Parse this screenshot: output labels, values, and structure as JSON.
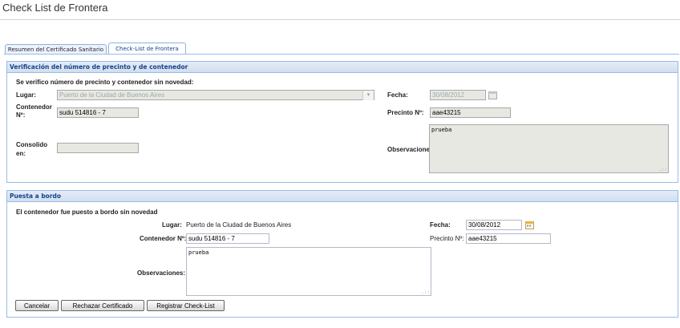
{
  "page_title": "Check List de Frontera",
  "tabs": [
    {
      "label": "Resumen del Certificado Sanitario",
      "active": false
    },
    {
      "label": "Check-List de Frontera",
      "active": true
    }
  ],
  "verificacion": {
    "header": "Verificación del número de precinto y de contenedor",
    "intro": "Se verifico número de precinto y contenedor sin novedad:",
    "lugar_label": "Lugar:",
    "lugar_value": "Puerto de la Ciudad de Buenos Aires",
    "fecha_label": "Fecha:",
    "fecha_value": "30/08/2012",
    "contenedor_label_1": "Contenedor",
    "contenedor_label_2": "Nº:",
    "contenedor_value": "sudu 514816 - 7",
    "precinto_label": "Precinto Nº:",
    "precinto_value": "aae43215",
    "consolido_label_1": "Consolido",
    "consolido_label_2": "en:",
    "consolido_value": "",
    "observaciones_label": "Observaciones:",
    "observaciones_value": "prueba"
  },
  "puesta": {
    "header": "Puesta a bordo",
    "intro": "El contenedor fue puesto a bordo sin novedad",
    "lugar_label": "Lugar:",
    "lugar_value": "Puerto de la Ciudad de Buenos Aires",
    "fecha_label": "Fecha:",
    "fecha_value": "30/08/2012",
    "contenedor_label": "Contenedor Nº:",
    "contenedor_value": "sudu 514816 - 7",
    "precinto_label": "Precinto Nº:",
    "precinto_value": "aae43215",
    "observaciones_label": "Observaciones:",
    "observaciones_value": "prueba"
  },
  "buttons": {
    "cancel": "Cancelar",
    "reject": "Rechazar Certificado",
    "register": "Registrar Check-List"
  },
  "icons": {
    "calendar": "calendar-icon",
    "combo": "chevron-down-icon",
    "resize": "resize-grip-icon"
  },
  "colors": {
    "panel_border": "#99bbe8",
    "header_text": "#15428b",
    "readonly_bg": "#e8e8e3"
  }
}
